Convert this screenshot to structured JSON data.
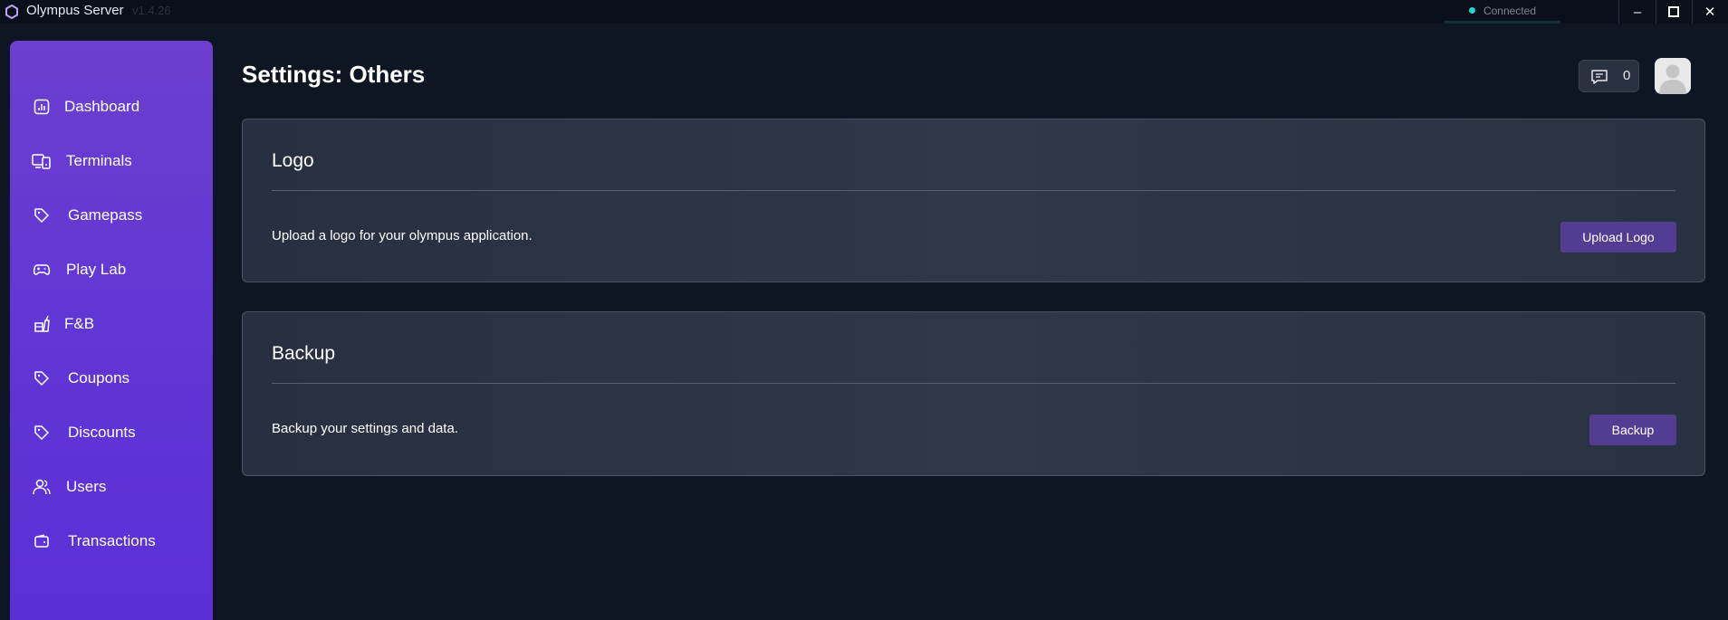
{
  "titlebar": {
    "app_title": "Olympus Server",
    "version": "v1.4.26",
    "status": "Connected",
    "status_color": "#1ed8cf",
    "minimize": "–",
    "maximize": "☐",
    "close": "✕"
  },
  "sidebar": {
    "items": [
      {
        "label": "Dashboard",
        "icon": "dashboard-icon"
      },
      {
        "label": "Terminals",
        "icon": "terminals-icon"
      },
      {
        "label": "Gamepass",
        "icon": "tag-icon"
      },
      {
        "label": "Play Lab",
        "icon": "gamepad-icon"
      },
      {
        "label": "F&B",
        "icon": "food-icon"
      },
      {
        "label": "Coupons",
        "icon": "tag-icon"
      },
      {
        "label": "Discounts",
        "icon": "tag-icon"
      },
      {
        "label": "Users",
        "icon": "users-icon"
      },
      {
        "label": "Transactions",
        "icon": "wallet-icon"
      }
    ]
  },
  "header": {
    "title": "Settings: Others",
    "messages_count": "0"
  },
  "cards": {
    "logo": {
      "title": "Logo",
      "description": "Upload a logo for your olympus application.",
      "button": "Upload Logo"
    },
    "backup": {
      "title": "Backup",
      "description": "Backup your settings and data.",
      "button": "Backup"
    }
  },
  "colors": {
    "accent": "#6236d4",
    "button": "#533d93",
    "background": "#0f1623"
  }
}
